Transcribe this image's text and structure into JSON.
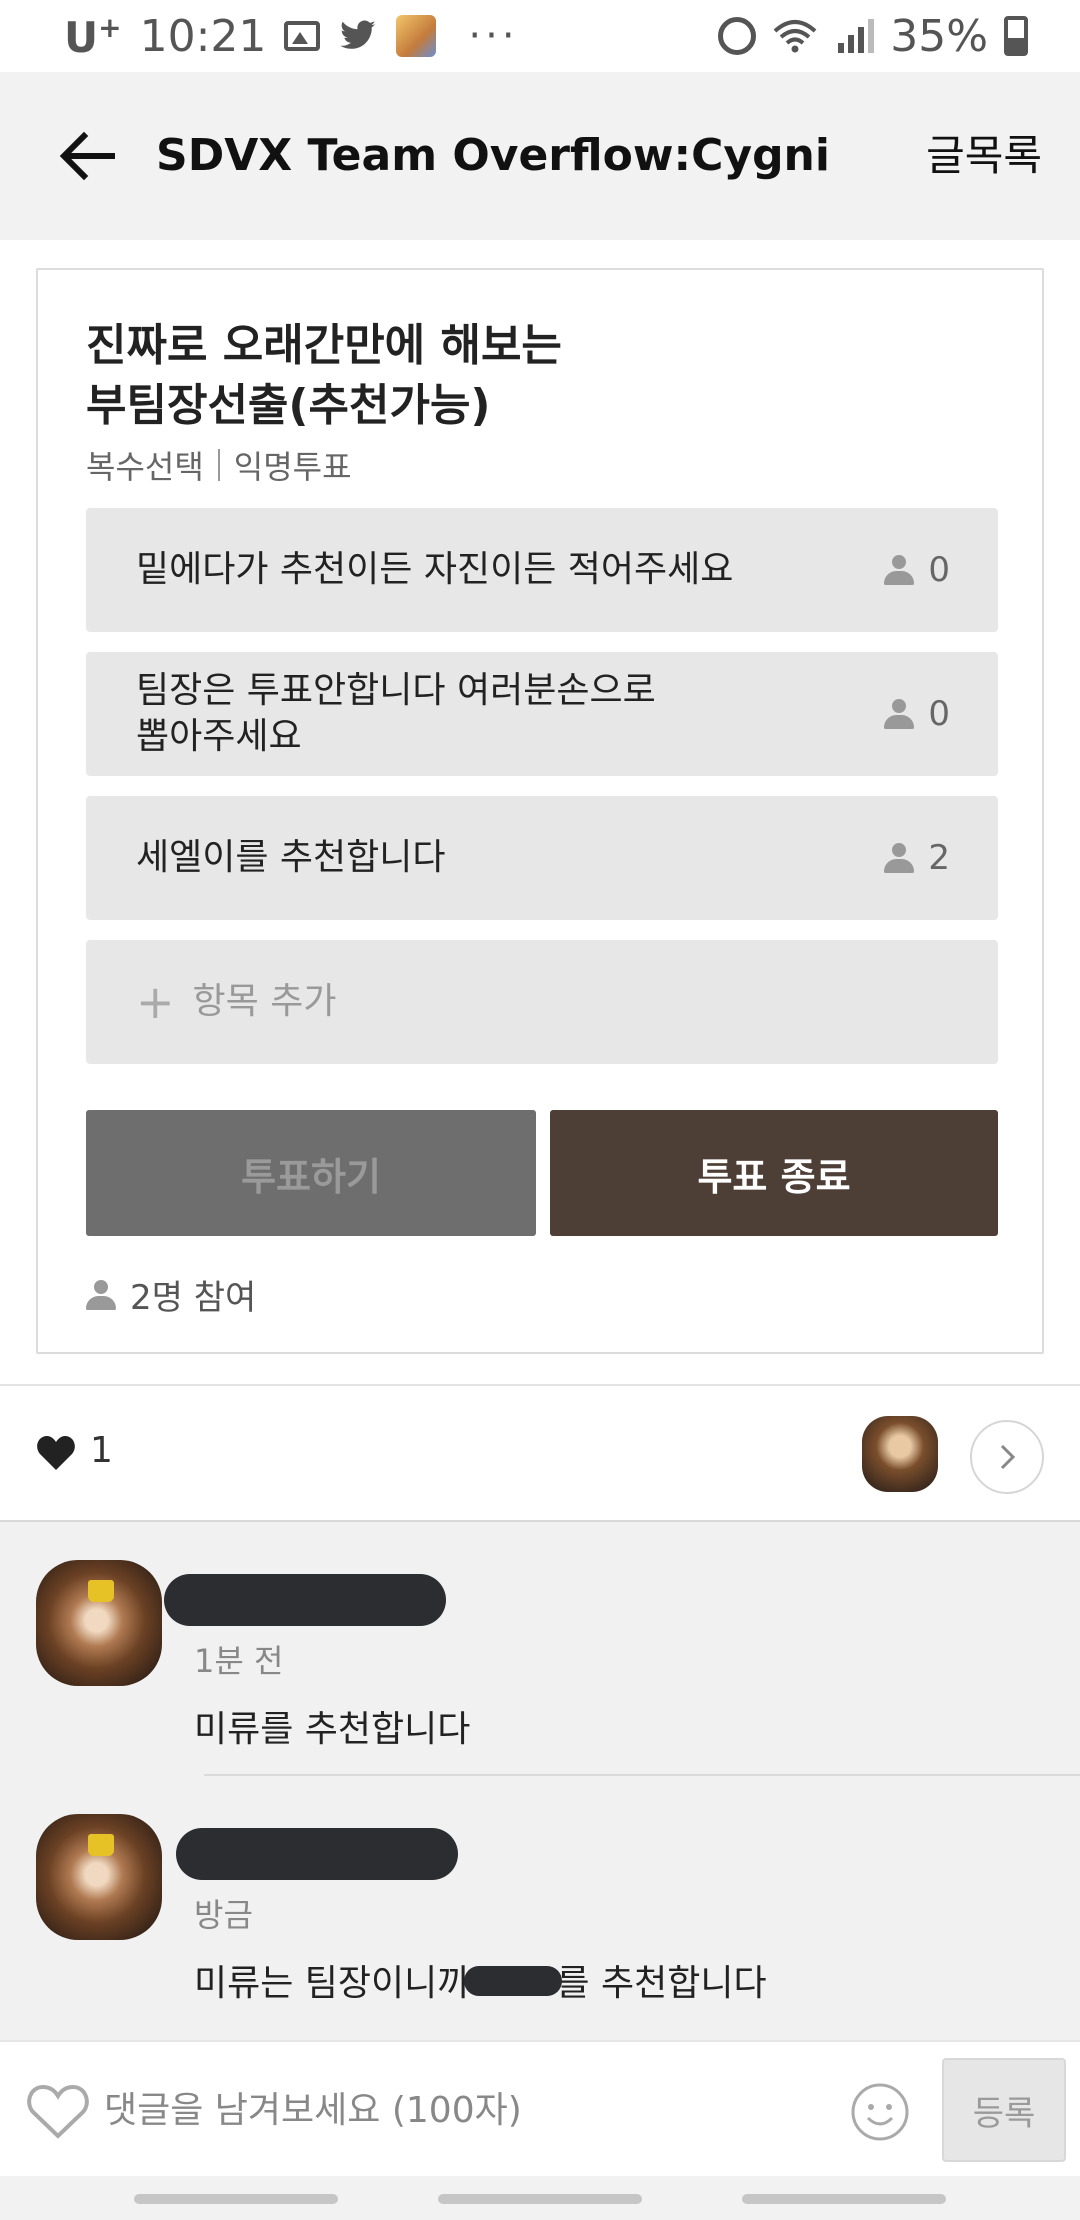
{
  "status_bar": {
    "carrier": "U",
    "carrier_sup": "+",
    "time": "10:21",
    "more": "···",
    "battery": "35%",
    "icons": [
      "image-icon",
      "twitter-bird-icon",
      "app-avatar-icon",
      "alarm-icon",
      "wifi-icon",
      "signal-icon",
      "battery-icon"
    ]
  },
  "header": {
    "title": "SDVX Team Overflow:Cygni",
    "action_label": "글목록"
  },
  "poll": {
    "title_line1": "진짜로 오래간만에 해보는",
    "title_line2": "부팀장선출(추천가능)",
    "meta_multi": "복수선택",
    "meta_anon": "익명투표",
    "options": [
      {
        "text": "밑에다가 추천이든 자진이든 적어주세요",
        "count": "0"
      },
      {
        "text_line1": "팀장은 투표안합니다 여러분손으로",
        "text_line2": "뽑아주세요",
        "count": "0"
      },
      {
        "text": "세엘이를 추천합니다",
        "count": "2"
      }
    ],
    "add_item": "항목 추가",
    "vote_button": "투표하기",
    "end_button": "투표 종료",
    "participants": "2명 참여",
    "colors": {
      "end_button_bg": "#4e3f36",
      "vote_button_bg": "#6e6e6e"
    }
  },
  "likes": {
    "count": "1"
  },
  "comments": [
    {
      "time": "1분 전",
      "body": "미류를 추천합니다"
    },
    {
      "time": "방금",
      "body_before": "미류는 팀장이니까",
      "body_after": "를 추천합니다"
    }
  ],
  "comment_input": {
    "placeholder": "댓글을 남겨보세요 (100자)",
    "submit_label": "등록"
  }
}
